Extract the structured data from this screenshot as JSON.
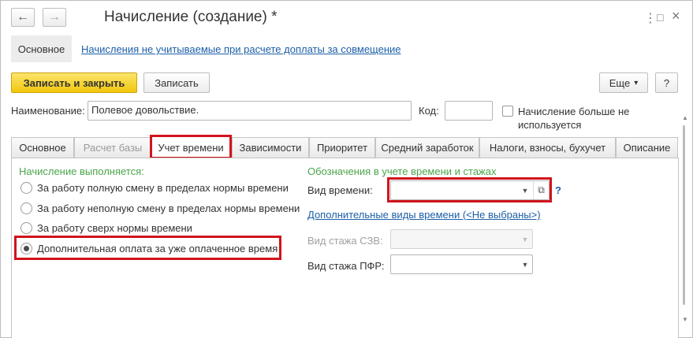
{
  "window": {
    "title": "Начисление (создание) *",
    "back_icon": "←",
    "forward_icon": "→",
    "more_icon": "⋮",
    "maximize_icon": "□",
    "close_icon": "×"
  },
  "sections": {
    "main_label": "Основное",
    "link_label": "Начисления не учитываемые при расчете доплаты за совмещение"
  },
  "toolbar": {
    "save_close": "Записать и закрыть",
    "save": "Записать",
    "more": "Еще",
    "more_arrow": "▾",
    "help": "?"
  },
  "header": {
    "name_label": "Наименование:",
    "name_value": "Полевое довольствие.",
    "code_label": "Код:",
    "code_value": "",
    "not_used_label_line1": "Начисление больше не",
    "not_used_label_line2": "используется"
  },
  "tabs": [
    {
      "label": "Основное"
    },
    {
      "label": "Расчет базы"
    },
    {
      "label": "Учет времени"
    },
    {
      "label": "Зависимости"
    },
    {
      "label": "Приоритет"
    },
    {
      "label": "Средний заработок"
    },
    {
      "label": "Налоги, взносы, бухучет"
    },
    {
      "label": "Описание"
    }
  ],
  "time_tab": {
    "accrual_heading": "Начисление выполняется:",
    "options": [
      {
        "label": "За работу полную смену в пределах нормы времени",
        "checked": false
      },
      {
        "label": "За работу неполную смену в пределах нормы времени",
        "checked": false
      },
      {
        "label": "За работу сверх нормы времени",
        "checked": false
      },
      {
        "label": "Дополнительная оплата за уже оплаченное время",
        "checked": true
      }
    ],
    "designations_heading": "Обозначения в учете времени и стажах",
    "time_type_label": "Вид времени:",
    "time_type_value": "",
    "time_type_help": "?",
    "additional_types_link": "Дополнительные виды времени (<Не выбраны>)",
    "szv_label": "Вид стажа СЗВ:",
    "szv_value": "",
    "pfr_label": "Вид стажа ПФР:",
    "pfr_value": "",
    "dropdown_arrow": "▼",
    "open_icon": "⧉"
  },
  "colors": {
    "accent_yellow": "#f1c70c",
    "link_blue": "#1c5fa8",
    "heading_green": "#4aa54a",
    "highlight_red": "#d0141c"
  }
}
